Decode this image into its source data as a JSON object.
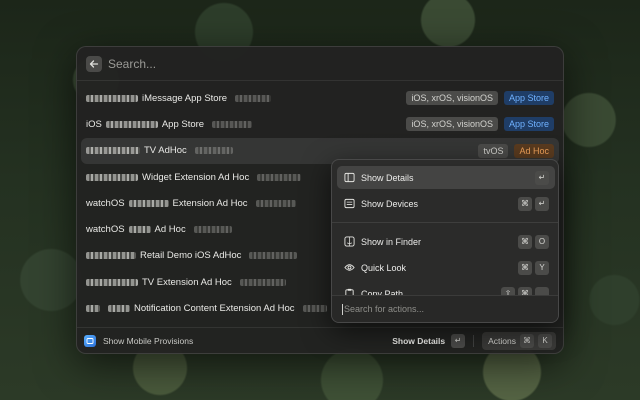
{
  "search": {
    "placeholder": "Search..."
  },
  "rows": [
    {
      "prefix": "",
      "text": "iMessage App Store",
      "tags": [
        "iOS, xrOS, visionOS",
        "App Store"
      ]
    },
    {
      "prefix": "iOS",
      "text": "App Store",
      "tags": [
        "iOS, xrOS, visionOS",
        "App Store"
      ]
    },
    {
      "prefix": "",
      "text": "TV AdHoc",
      "tags": [
        "tvOS",
        "Ad Hoc"
      ]
    },
    {
      "prefix": "",
      "text": "Widget Extension Ad Hoc",
      "tags": []
    },
    {
      "prefix": "watchOS",
      "text": "Extension Ad Hoc",
      "tags": []
    },
    {
      "prefix": "watchOS",
      "text": "Ad Hoc",
      "tags": []
    },
    {
      "prefix": "",
      "text": "Retail Demo iOS AdHoc",
      "tags": []
    },
    {
      "prefix": "",
      "text": "TV Extension Ad Hoc",
      "tags": []
    },
    {
      "prefix": "",
      "text": "Notification Content Extension Ad Hoc",
      "tags": []
    }
  ],
  "footer": {
    "title": "Show Mobile Provisions",
    "primary_action": "Show Details",
    "primary_key": "↵",
    "actions_label": "Actions",
    "actions_key1": "⌘",
    "actions_key2": "K"
  },
  "actions_panel": {
    "items": [
      {
        "label": "Show Details",
        "icon": "sidebar-icon",
        "keys": [
          "↵"
        ]
      },
      {
        "label": "Show Devices",
        "icon": "list-icon",
        "keys": [
          "⌘",
          "↵"
        ]
      },
      {
        "label": "Show in Finder",
        "icon": "finder-icon",
        "keys": [
          "⌘",
          "O"
        ]
      },
      {
        "label": "Quick Look",
        "icon": "eye-icon",
        "keys": [
          "⌘",
          "Y"
        ]
      },
      {
        "label": "Copy Path",
        "icon": "clipboard-icon",
        "keys": [
          "⇧",
          "⌘"
        ]
      }
    ],
    "search_placeholder": "Search for actions..."
  },
  "colors": {
    "app_store_tag": "#6fb1ff",
    "ad_hoc_tag": "#f2a35a"
  }
}
